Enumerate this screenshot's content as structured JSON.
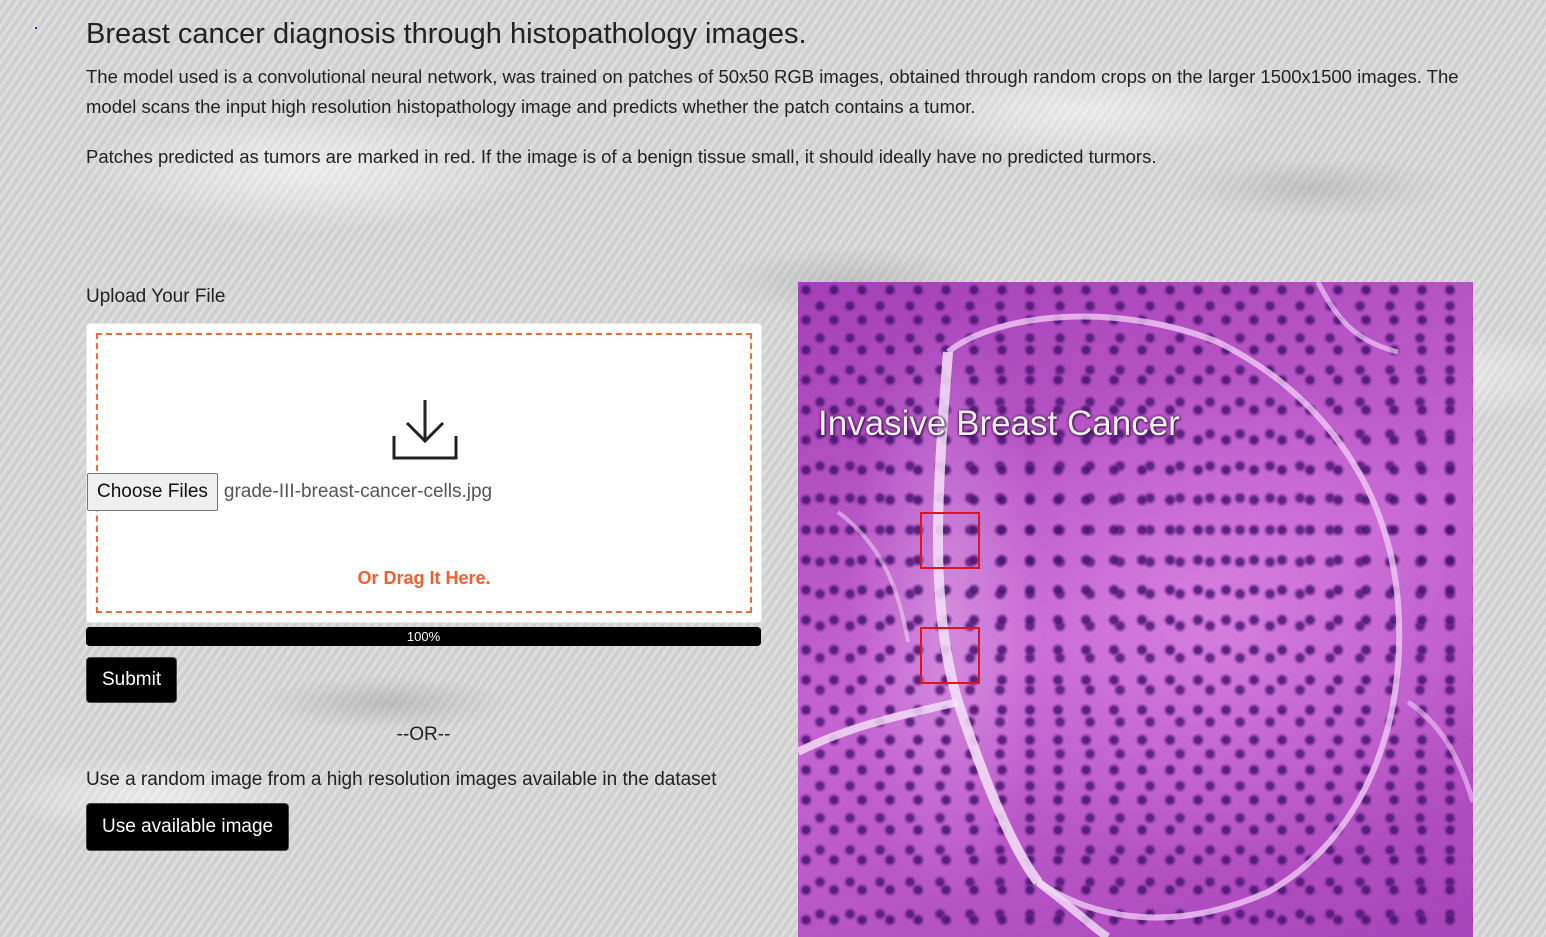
{
  "page": {
    "title": "Breast cancer diagnosis through histopathology images.",
    "description": "The model used is a convolutional neural network, was trained on patches of 50x50 RGB images, obtained through random crops on the larger 1500x1500 images. The model scans the input high resolution histopathology image and predicts whether the patch contains a tumor.",
    "description2": "Patches predicted as tumors are marked in red. If the image is of a benign tissue small, it should ideally have no predicted turmors."
  },
  "upload": {
    "label": "Upload Your File",
    "choose_button": "Choose Files",
    "file_name": "grade-III-breast-cancer-cells.jpg",
    "drag_text": "Or Drag It Here.",
    "icon": "download-icon"
  },
  "progress": {
    "value": 1.0,
    "label": "100%"
  },
  "actions": {
    "submit_label": "Submit",
    "or_text": "--OR--",
    "random_text": "Use a random image from a high resolution images available in the dataset",
    "use_available_label": "Use available image"
  },
  "result_image": {
    "overlay_text": "Invasive Breast Cancer",
    "tumor_patches": 2
  },
  "colors": {
    "accent": "#f06a3a",
    "patch_outline": "#e0121e",
    "button_bg": "#000000"
  }
}
